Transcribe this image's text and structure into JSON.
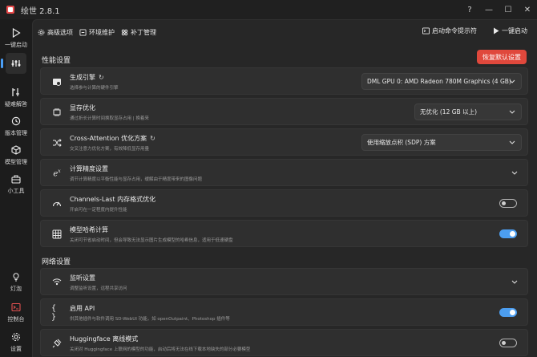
{
  "window": {
    "title": "绘世 2.8.1",
    "controls": [
      "?",
      "—",
      "☐",
      "✕"
    ]
  },
  "sidebar": {
    "items": [
      {
        "label": "一键启动",
        "icon": "play-icon"
      },
      {
        "label": "",
        "icon": "settings-list-icon"
      },
      {
        "label": "疑难解答",
        "icon": "tools-icon"
      },
      {
        "label": "版本管理",
        "icon": "history-icon"
      },
      {
        "label": "模型管理",
        "icon": "cube-icon"
      },
      {
        "label": "小工具",
        "icon": "toolbox-icon"
      },
      {
        "label": "灯泡",
        "icon": "lightbulb-icon"
      },
      {
        "label": "控制台",
        "icon": "console-icon"
      },
      {
        "label": "设置",
        "icon": "gear-icon"
      }
    ]
  },
  "toolbar": {
    "tabs": [
      {
        "label": "高级选项",
        "icon": "gear-icon"
      },
      {
        "label": "环境维护",
        "icon": "wrench-icon"
      },
      {
        "label": "补丁管理",
        "icon": "patch-icon"
      }
    ],
    "console_label": "启动命令提示符",
    "launch_label": "一键启动"
  },
  "performance": {
    "title": "性能设置",
    "reset_label": "恢复默认设置",
    "cards": [
      {
        "title": "生成引擎",
        "desc": "选择参与计算的硬件引擎",
        "control": "dropdown",
        "value": "DML GPU 0: AMD Radeon 780M Graphics (4 GB)",
        "icon": "engine-icon"
      },
      {
        "title": "显存优化",
        "desc": "通过折长计算时间换取显存占用 | 换着来",
        "control": "dropdown",
        "value": "无优化 (12 GB 以上)",
        "icon": "memory-icon"
      },
      {
        "title": "Cross-Attention 优化方案",
        "desc": "交叉注意力优化方案，有效降低显存用量",
        "control": "dropdown",
        "value": "使用缩放点积 (SDP) 方案",
        "icon": "shuffle-icon"
      },
      {
        "title": "计算精度设置",
        "desc": "调节计算精度以平衡性能与显存占用，缓解由于精度带来的图像问题",
        "control": "expander",
        "icon": "precision-icon"
      },
      {
        "title": "Channels-Last 内存格式优化",
        "desc": "开启可在一定程度内提升性能",
        "control": "toggle",
        "state": false,
        "icon": "speed-icon"
      },
      {
        "title": "模型哈希计算",
        "desc": "关闭可节省启动时间，但会导致无法显示图片生成模型的哈希信息，适用于低速硬盘",
        "control": "toggle",
        "state": true,
        "icon": "hash-icon"
      }
    ]
  },
  "network": {
    "title": "网络设置",
    "cards": [
      {
        "title": "监听设置",
        "desc": "调整监听设置，远程共享访问",
        "control": "expander",
        "icon": "broadcast-icon"
      },
      {
        "title": "启用 API",
        "desc": "供其他插件与软件调用 SD-WebUI 功能，如 openOutpaint、Photoshop 插件等",
        "control": "toggle",
        "state": true,
        "icon": "braces-icon"
      },
      {
        "title": "Huggingface 离线模式",
        "desc": "关闭对 Huggingface 上联网的模型的功能，启动后将无法在线下载本地缺失的部分必要模型",
        "control": "toggle",
        "state": false,
        "icon": "plug-icon"
      }
    ]
  }
}
